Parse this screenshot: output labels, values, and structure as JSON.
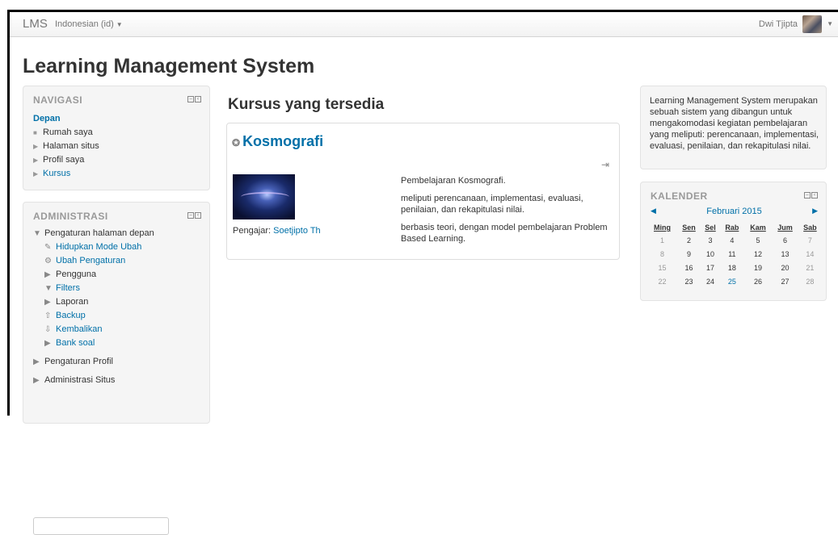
{
  "navbar": {
    "brand": "LMS",
    "language": "Indonesian (id)",
    "user_name": "Dwi Tjipta"
  },
  "page_title": "Learning Management System",
  "navigation": {
    "header": "NAVIGASI",
    "items": [
      {
        "label": "Depan"
      },
      {
        "label": "Rumah saya"
      },
      {
        "label": "Halaman situs"
      },
      {
        "label": "Profil saya"
      },
      {
        "label": "Kursus"
      }
    ]
  },
  "administration": {
    "header": "ADMINISTRASI",
    "group_label": "Pengaturan halaman depan",
    "items": [
      {
        "label": "Hidupkan Mode Ubah",
        "icon": "pencil-icon"
      },
      {
        "label": "Ubah Pengaturan",
        "icon": "gear-icon"
      },
      {
        "label": "Pengguna",
        "icon": "triangle-right-icon"
      },
      {
        "label": "Filters",
        "icon": "filter-icon"
      },
      {
        "label": "Laporan",
        "icon": "triangle-right-icon"
      },
      {
        "label": "Backup",
        "icon": "upload-icon"
      },
      {
        "label": "Kembalikan",
        "icon": "download-icon"
      },
      {
        "label": "Bank soal",
        "icon": "triangle-right-icon"
      }
    ],
    "profile_settings": "Pengaturan Profil",
    "site_admin": "Administrasi Situs",
    "search_value": ""
  },
  "main": {
    "section_title": "Kursus yang tersedia",
    "course": {
      "name": "Kosmografi",
      "teacher_label": "Pengajar:",
      "teacher_name": "Soetjipto Th",
      "summary": [
        "Pembelajaran Kosmografi.",
        "meliputi perencanaan, implementasi, evaluasi, penilaian, dan rekapitulasi nilai.",
        "berbasis teori, dengan model pembelajaran Problem Based Learning."
      ]
    }
  },
  "description": "Learning Management System merupakan sebuah sistem yang dibangun untuk mengakomodasi kegiatan pembelajaran yang meliputi: perencanaan, implementasi, evaluasi, penilaian, dan rekapitulasi nilai.",
  "calendar": {
    "header": "KALENDER",
    "month": "Februari 2015",
    "weekdays": [
      "Ming",
      "Sen",
      "Sel",
      "Rab",
      "Kam",
      "Jum",
      "Sab"
    ],
    "weeks": [
      [
        "1",
        "2",
        "3",
        "4",
        "5",
        "6",
        "7"
      ],
      [
        "8",
        "9",
        "10",
        "11",
        "12",
        "13",
        "14"
      ],
      [
        "15",
        "16",
        "17",
        "18",
        "19",
        "20",
        "21"
      ],
      [
        "22",
        "23",
        "24",
        "25",
        "26",
        "27",
        "28"
      ]
    ],
    "today": "25"
  }
}
